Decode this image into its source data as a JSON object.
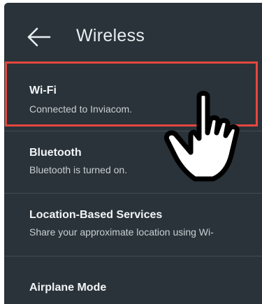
{
  "header": {
    "title": "Wireless",
    "back_icon": "arrow-left-icon"
  },
  "settings": [
    {
      "label": "Wi-Fi",
      "sub": "Connected to Inviacom."
    },
    {
      "label": "Bluetooth",
      "sub": "Bluetooth is turned on."
    },
    {
      "label": "Location-Based Services",
      "sub": "Share your approximate location using Wi-"
    },
    {
      "label": "Airplane Mode"
    }
  ],
  "annotation": {
    "highlight_color": "#e5473e",
    "pointer_icon": "pointing-hand-icon"
  },
  "colors": {
    "background": "#2a3339",
    "text_primary": "#f2f5f7",
    "text_secondary": "#c9d0d4"
  }
}
